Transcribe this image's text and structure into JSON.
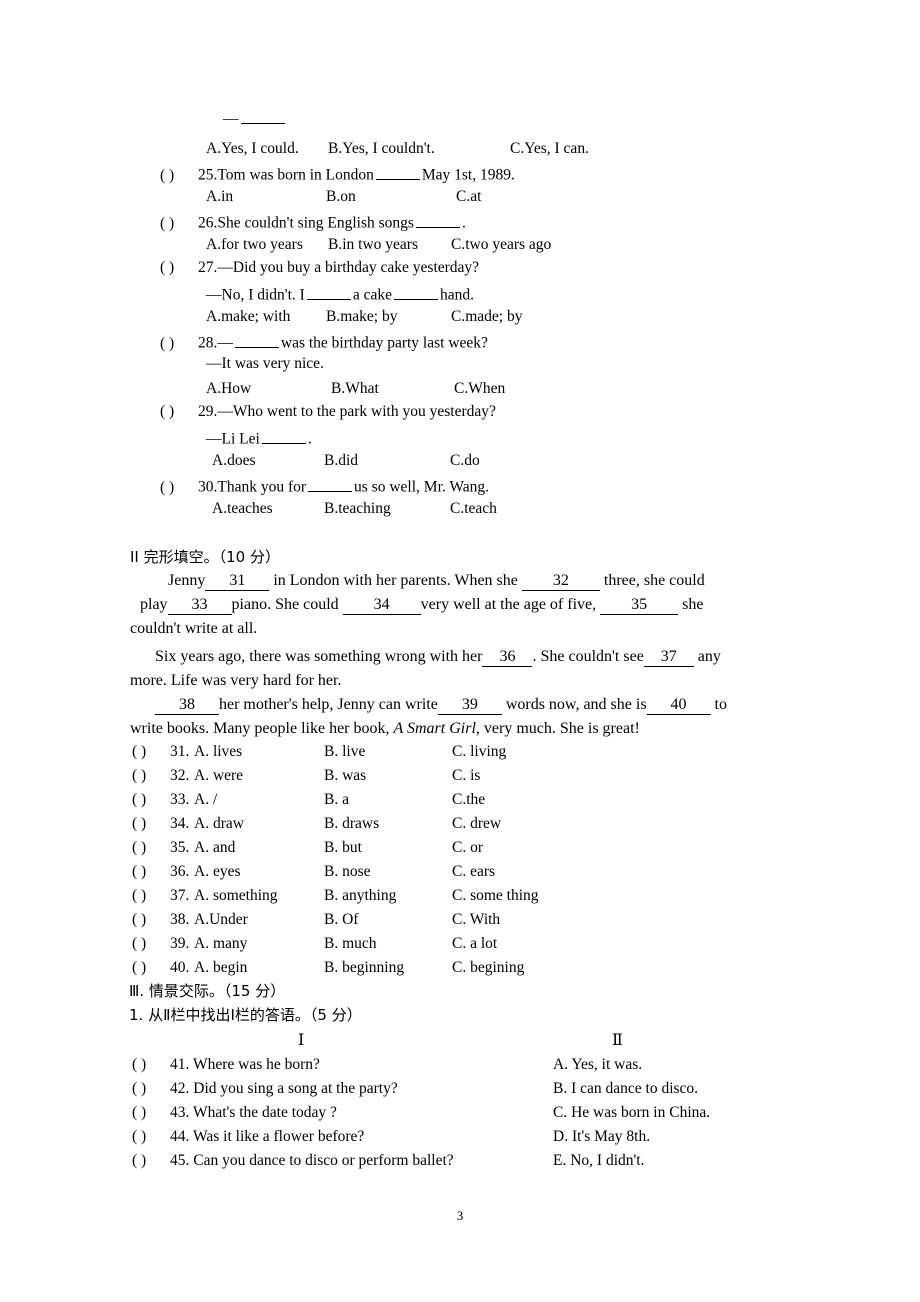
{
  "page": {
    "number": "3"
  },
  "top_fragment": {
    "dash": "—",
    "blank": ""
  },
  "question_24_options": {
    "a": "A.Yes, I could.",
    "b": "B.Yes, I couldn't.",
    "c": "C.Yes, I can."
  },
  "questions": [
    {
      "paren": "(      )",
      "number": "25.",
      "stem_before": "Tom was born in London",
      "stem_after": "May 1st, 1989.",
      "options": {
        "a": "A.in",
        "b": "B.on",
        "c": "C.at"
      }
    },
    {
      "paren": "(      )",
      "number": "26.",
      "stem_before": "She couldn't sing English songs",
      "stem_after": ".",
      "options": {
        "a": "A.for two years",
        "b": "B.in two years",
        "c": "C.two years ago"
      }
    },
    {
      "paren": "(      )",
      "number": "27.",
      "stem_line1": "—Did you buy a birthday cake yesterday?",
      "stem_line2_a": "—No, I didn't. I",
      "stem_line2_b": "a cake",
      "stem_line2_c": "hand.",
      "options": {
        "a": "A.make; with",
        "b": "B.make; by",
        "c": "C.made; by"
      }
    },
    {
      "paren": "(      )",
      "number": "28.",
      "stem_line1_a": "—",
      "stem_line1_b": "was the birthday party last week?",
      "stem_line2": "—It was very nice.",
      "options": {
        "a": "A.How",
        "b": "B.What",
        "c": "C.When"
      }
    },
    {
      "paren": "(      )",
      "number": "29.",
      "stem_line1": "—Who went to the park with you yesterday?",
      "stem_line2_a": "—Li Lei",
      "stem_line2_b": ".",
      "options": {
        "a": "A.does",
        "b": "B.did",
        "c": "C.do"
      }
    },
    {
      "paren": "(      )",
      "number": "30.",
      "stem_before": "Thank you for",
      "stem_after": "us so well, Mr. Wang.",
      "options": {
        "a": "A.teaches",
        "b": "B.teaching",
        "c": "C.teach"
      }
    }
  ],
  "section_cloze": {
    "heading": "II 完形填空。（10 分）",
    "passage": {
      "l1_a": "Jenny",
      "l1_n31": "31",
      "l1_b": "in London with her parents. When she",
      "l1_n32": "32",
      "l1_c": "three, she could",
      "l2_a": "play",
      "l2_n33": "33",
      "l2_b": "piano. She could",
      "l2_n34": "34",
      "l2_c": "very well at the age of five,",
      "l2_n35": "35",
      "l2_d": "she",
      "l3": "couldn't write at all.",
      "l4_a": "Six years ago, there was something wrong with her",
      "l4_n36": "36",
      "l4_b": ". She couldn't see",
      "l4_n37": "37",
      "l4_c": "any",
      "l5": "more. Life was very hard for her.",
      "l6_n38": "38",
      "l6_a": "her mother's help, Jenny can write",
      "l6_n39": "39",
      "l6_b": "words now, and she is",
      "l6_n40": "40",
      "l6_c": "to",
      "l7_a": "write books. Many people like her book,",
      "l7_italic": "A Smart Girl",
      "l7_b": ", very much. She is great!"
    },
    "items": [
      {
        "paren": "(      )",
        "number": "31.",
        "a": "A. lives",
        "b": "B. live",
        "c": "C. living"
      },
      {
        "paren": "(      )",
        "number": "32.",
        "a": "A. were",
        "b": "B. was",
        "c": "C. is"
      },
      {
        "paren": "(      )",
        "number": "33.",
        "a": "A. /",
        "b": "B. a",
        "c": "C.the"
      },
      {
        "paren": "(      )",
        "number": "34.",
        "a": "A. draw",
        "b": "B. draws",
        "c": "C. drew"
      },
      {
        "paren": "(      )",
        "number": "35.",
        "a": "A. and",
        "b": "B. but",
        "c": "C. or"
      },
      {
        "paren": "(      )",
        "number": "36.",
        "a": "A. eyes",
        "b": "B. nose",
        "c": "C. ears"
      },
      {
        "paren": "(      )",
        "number": "37.",
        "a": "A. something",
        "b": "B. anything",
        "c": "C. some thing"
      },
      {
        "paren": "(      )",
        "number": "38.",
        "a": "A.Under",
        "b": "B. Of",
        "c": "C. With"
      },
      {
        "paren": "(      )",
        "number": "39.",
        "a": "A. many",
        "b": "B. much",
        "c": " C. a lot"
      },
      {
        "paren": "(      )",
        "number": "40.",
        "a": "A. begin",
        "b": "B. beginning",
        "c": "C. begining"
      }
    ]
  },
  "section_matching": {
    "heading": "Ⅲ. 情景交际。（15 分）",
    "subheading": "1. 从Ⅱ栏中找出Ⅰ栏的答语。（5 分）",
    "col1_head": "Ⅰ",
    "col2_head": "Ⅱ",
    "questions": [
      {
        "paren": "(      )",
        "text": "41. Where was he born?"
      },
      {
        "paren": "(      )",
        "text": "42. Did you sing a song at the party?"
      },
      {
        "paren": "(      )",
        "text": "43. What's the date today ?"
      },
      {
        "paren": "(      )",
        "text": "44. Was it like a flower before?"
      },
      {
        "paren": "(      )",
        "text": "45. Can you dance to disco or perform ballet?"
      }
    ],
    "answers": [
      "A. Yes, it was.",
      "B. I can dance to disco.",
      " C. He was born in China.",
      " D. It's May 8th.",
      "  E. No, I didn't."
    ]
  }
}
